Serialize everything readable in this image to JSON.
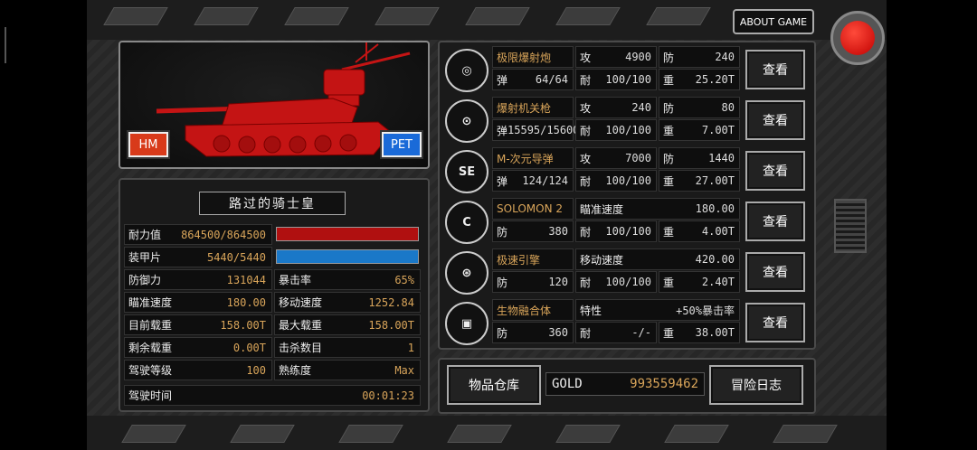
{
  "header": {
    "about_label": "ABOUT GAME"
  },
  "tank": {
    "hm_label": "HM",
    "pet_label": "PET",
    "pilot_name": "路过的骑士皇"
  },
  "stats": {
    "hp": {
      "label": "耐力值",
      "value": "864500/864500",
      "fill": 1.0
    },
    "armor": {
      "label": "装甲片",
      "value": "5440/5440",
      "fill": 1.0
    },
    "rows": [
      [
        {
          "label": "防御力",
          "value": "131044"
        },
        {
          "label": "暴击率",
          "value": "65%"
        }
      ],
      [
        {
          "label": "瞄准速度",
          "value": "180.00"
        },
        {
          "label": "移动速度",
          "value": "1252.84"
        }
      ],
      [
        {
          "label": "目前载重",
          "value": "158.00T"
        },
        {
          "label": "最大载重",
          "value": "158.00T"
        }
      ],
      [
        {
          "label": "剩余载重",
          "value": "0.00T"
        },
        {
          "label": "击杀数目",
          "value": "1"
        }
      ],
      [
        {
          "label": "驾驶等级",
          "value": "100"
        },
        {
          "label": "熟练度",
          "value": "Max"
        }
      ]
    ],
    "time": {
      "label": "驾驶时间",
      "value": "00:01:23"
    }
  },
  "weapons": [
    {
      "icon": "cannon-icon",
      "icon_text": "◎",
      "name": "极限爆射炮",
      "r1": [
        {
          "k": "攻",
          "v": "4900"
        },
        {
          "k": "防",
          "v": "240"
        }
      ],
      "r0": {
        "k": "弹",
        "v": "64/64"
      },
      "r2": [
        {
          "k": "耐",
          "v": "100/100"
        },
        {
          "k": "重",
          "v": "25.20T"
        }
      ],
      "btn": "查看"
    },
    {
      "icon": "machinegun-icon",
      "icon_text": "⊙",
      "name": "爆射机关枪",
      "r1": [
        {
          "k": "攻",
          "v": "240"
        },
        {
          "k": "防",
          "v": "80"
        }
      ],
      "r0": {
        "k": "弹",
        "v": "15595/15600"
      },
      "r2": [
        {
          "k": "耐",
          "v": "100/100"
        },
        {
          "k": "重",
          "v": "7.00T"
        }
      ],
      "btn": "查看"
    },
    {
      "icon": "se-missile-icon",
      "icon_text": "SE",
      "name": "M-次元导弹",
      "r1": [
        {
          "k": "攻",
          "v": "7000"
        },
        {
          "k": "防",
          "v": "1440"
        }
      ],
      "r0": {
        "k": "弹",
        "v": "124/124"
      },
      "r2": [
        {
          "k": "耐",
          "v": "100/100"
        },
        {
          "k": "重",
          "v": "27.00T"
        }
      ],
      "btn": "查看"
    },
    {
      "icon": "c-unit-icon",
      "icon_text": "C",
      "name": "SOLOMON 2",
      "r1": [
        {
          "k": "瞄准速度",
          "v": "180.00"
        }
      ],
      "r0": {
        "k": "防",
        "v": "380"
      },
      "r2": [
        {
          "k": "耐",
          "v": "100/100"
        },
        {
          "k": "重",
          "v": "4.00T"
        }
      ],
      "btn": "查看"
    },
    {
      "icon": "engine-icon",
      "icon_text": "⊛",
      "name": "极速引擎",
      "r1": [
        {
          "k": "移动速度",
          "v": "420.00"
        }
      ],
      "r0": {
        "k": "防",
        "v": "120"
      },
      "r2": [
        {
          "k": "耐",
          "v": "100/100"
        },
        {
          "k": "重",
          "v": "2.40T"
        }
      ],
      "btn": "查看"
    },
    {
      "icon": "bio-core-icon",
      "icon_text": "▣",
      "name": "生物融合体",
      "r1": [
        {
          "k": "特性",
          "v": "+50%暴击率"
        }
      ],
      "r0": {
        "k": "防",
        "v": "360"
      },
      "r2": [
        {
          "k": "耐",
          "v": "-/-"
        },
        {
          "k": "重",
          "v": "38.00T"
        }
      ],
      "btn": "查看"
    }
  ],
  "bottom": {
    "storage_label": "物品仓库",
    "gold_label": "GOLD",
    "gold_value": "993559462",
    "log_label": "冒险日志"
  }
}
